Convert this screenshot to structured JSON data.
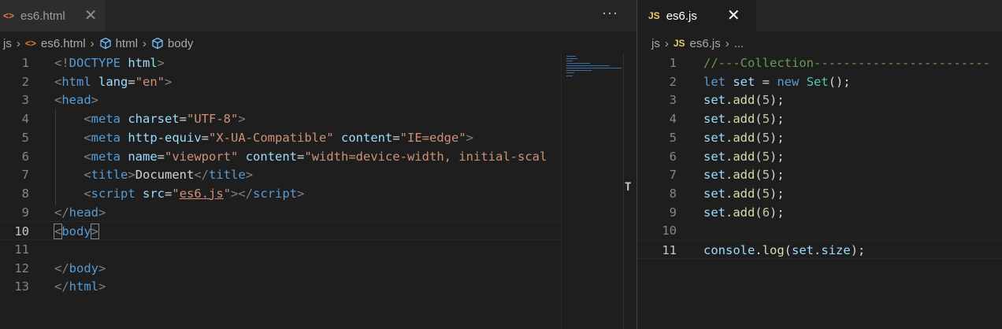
{
  "left_tab": {
    "icon": "<>",
    "label": "es6.html",
    "close": "✕"
  },
  "more_actions": "···",
  "right_tab": {
    "icon": "JS",
    "label": "es6.js",
    "close": "✕"
  },
  "left_breadcrumb": {
    "root": "js",
    "file": "es6.html",
    "node1": "html",
    "node2": "body"
  },
  "right_breadcrumb": {
    "root": "js",
    "file": "es6.js",
    "tail": "..."
  },
  "left_lines": [
    {
      "num": "1",
      "tokens": [
        [
          "t-brk",
          "<!"
        ],
        [
          "t-tag",
          "DOCTYPE"
        ],
        [
          "t-txt",
          " "
        ],
        [
          "t-attr",
          "html"
        ],
        [
          "t-brk",
          ">"
        ]
      ]
    },
    {
      "num": "2",
      "tokens": [
        [
          "t-brk",
          "<"
        ],
        [
          "t-tag",
          "html"
        ],
        [
          "t-txt",
          " "
        ],
        [
          "t-attr",
          "lang"
        ],
        [
          "t-txt",
          "="
        ],
        [
          "t-str",
          "\"en\""
        ],
        [
          "t-brk",
          ">"
        ]
      ]
    },
    {
      "num": "3",
      "tokens": [
        [
          "t-brk",
          "<"
        ],
        [
          "t-tag",
          "head"
        ],
        [
          "t-brk",
          ">"
        ]
      ]
    },
    {
      "num": "4",
      "tokens": [
        [
          "t-txt",
          "    "
        ],
        [
          "t-brk",
          "<"
        ],
        [
          "t-tag",
          "meta"
        ],
        [
          "t-txt",
          " "
        ],
        [
          "t-attr",
          "charset"
        ],
        [
          "t-txt",
          "="
        ],
        [
          "t-str",
          "\"UTF-8\""
        ],
        [
          "t-brk",
          ">"
        ]
      ]
    },
    {
      "num": "5",
      "tokens": [
        [
          "t-txt",
          "    "
        ],
        [
          "t-brk",
          "<"
        ],
        [
          "t-tag",
          "meta"
        ],
        [
          "t-txt",
          " "
        ],
        [
          "t-attr",
          "http-equiv"
        ],
        [
          "t-txt",
          "="
        ],
        [
          "t-str",
          "\"X-UA-Compatible\""
        ],
        [
          "t-txt",
          " "
        ],
        [
          "t-attr",
          "content"
        ],
        [
          "t-txt",
          "="
        ],
        [
          "t-str",
          "\"IE=edge\""
        ],
        [
          "t-brk",
          ">"
        ]
      ]
    },
    {
      "num": "6",
      "tokens": [
        [
          "t-txt",
          "    "
        ],
        [
          "t-brk",
          "<"
        ],
        [
          "t-tag",
          "meta"
        ],
        [
          "t-txt",
          " "
        ],
        [
          "t-attr",
          "name"
        ],
        [
          "t-txt",
          "="
        ],
        [
          "t-str",
          "\"viewport\""
        ],
        [
          "t-txt",
          " "
        ],
        [
          "t-attr",
          "content"
        ],
        [
          "t-txt",
          "="
        ],
        [
          "t-str",
          "\"width=device-width, initial-scal"
        ]
      ]
    },
    {
      "num": "7",
      "tokens": [
        [
          "t-txt",
          "    "
        ],
        [
          "t-brk",
          "<"
        ],
        [
          "t-tag",
          "title"
        ],
        [
          "t-brk",
          ">"
        ],
        [
          "t-txt",
          "Document"
        ],
        [
          "t-brk",
          "</"
        ],
        [
          "t-tag",
          "title"
        ],
        [
          "t-brk",
          ">"
        ]
      ]
    },
    {
      "num": "8",
      "tokens": [
        [
          "t-txt",
          "    "
        ],
        [
          "t-brk",
          "<"
        ],
        [
          "t-tag",
          "script"
        ],
        [
          "t-txt",
          " "
        ],
        [
          "t-attr",
          "src"
        ],
        [
          "t-txt",
          "="
        ],
        [
          "t-str",
          "\""
        ],
        [
          "t-str t-ul",
          "es6.js"
        ],
        [
          "t-str",
          "\""
        ],
        [
          "t-brk",
          "></"
        ],
        [
          "t-tag",
          "script"
        ],
        [
          "t-brk",
          ">"
        ]
      ]
    },
    {
      "num": "9",
      "tokens": [
        [
          "t-brk",
          "</"
        ],
        [
          "t-tag",
          "head"
        ],
        [
          "t-brk",
          ">"
        ]
      ]
    },
    {
      "num": "10",
      "current": true,
      "tokens": [
        [
          "t-brk bracket-match",
          "<"
        ],
        [
          "t-tag",
          "body"
        ],
        [
          "t-brk bracket-match",
          ">"
        ]
      ]
    },
    {
      "num": "11",
      "tokens": []
    },
    {
      "num": "12",
      "tokens": [
        [
          "t-brk",
          "</"
        ],
        [
          "t-tag",
          "body"
        ],
        [
          "t-brk",
          ">"
        ]
      ]
    },
    {
      "num": "13",
      "tokens": [
        [
          "t-brk",
          "</"
        ],
        [
          "t-tag",
          "html"
        ],
        [
          "t-brk",
          ">"
        ]
      ]
    }
  ],
  "right_lines": [
    {
      "num": "1",
      "tokens": [
        [
          "t-cmt",
          "//---Collection------------------------"
        ]
      ]
    },
    {
      "num": "2",
      "tokens": [
        [
          "t-kw",
          "let"
        ],
        [
          "t-punc",
          " "
        ],
        [
          "t-var",
          "set"
        ],
        [
          "t-punc",
          " = "
        ],
        [
          "t-kw",
          "new"
        ],
        [
          "t-punc",
          " "
        ],
        [
          "t-cls",
          "Set"
        ],
        [
          "t-punc",
          "();"
        ]
      ]
    },
    {
      "num": "3",
      "tokens": [
        [
          "t-var",
          "set"
        ],
        [
          "t-punc",
          "."
        ],
        [
          "t-fn",
          "add"
        ],
        [
          "t-punc",
          "("
        ],
        [
          "t-num",
          "5"
        ],
        [
          "t-punc",
          ");"
        ]
      ]
    },
    {
      "num": "4",
      "tokens": [
        [
          "t-var",
          "set"
        ],
        [
          "t-punc",
          "."
        ],
        [
          "t-fn",
          "add"
        ],
        [
          "t-punc",
          "("
        ],
        [
          "t-num",
          "5"
        ],
        [
          "t-punc",
          ");"
        ]
      ]
    },
    {
      "num": "5",
      "tokens": [
        [
          "t-var",
          "set"
        ],
        [
          "t-punc",
          "."
        ],
        [
          "t-fn",
          "add"
        ],
        [
          "t-punc",
          "("
        ],
        [
          "t-num",
          "5"
        ],
        [
          "t-punc",
          ");"
        ]
      ]
    },
    {
      "num": "6",
      "tokens": [
        [
          "t-var",
          "set"
        ],
        [
          "t-punc",
          "."
        ],
        [
          "t-fn",
          "add"
        ],
        [
          "t-punc",
          "("
        ],
        [
          "t-num",
          "5"
        ],
        [
          "t-punc",
          ");"
        ]
      ]
    },
    {
      "num": "7",
      "tokens": [
        [
          "t-var",
          "set"
        ],
        [
          "t-punc",
          "."
        ],
        [
          "t-fn",
          "add"
        ],
        [
          "t-punc",
          "("
        ],
        [
          "t-num",
          "5"
        ],
        [
          "t-punc",
          ");"
        ]
      ]
    },
    {
      "num": "8",
      "tokens": [
        [
          "t-var",
          "set"
        ],
        [
          "t-punc",
          "."
        ],
        [
          "t-fn",
          "add"
        ],
        [
          "t-punc",
          "("
        ],
        [
          "t-num",
          "5"
        ],
        [
          "t-punc",
          ");"
        ]
      ]
    },
    {
      "num": "9",
      "tokens": [
        [
          "t-var",
          "set"
        ],
        [
          "t-punc",
          "."
        ],
        [
          "t-fn",
          "add"
        ],
        [
          "t-punc",
          "("
        ],
        [
          "t-num",
          "6"
        ],
        [
          "t-punc",
          ");"
        ]
      ]
    },
    {
      "num": "10",
      "tokens": []
    },
    {
      "num": "11",
      "current": true,
      "tokens": [
        [
          "t-var",
          "console"
        ],
        [
          "t-punc",
          "."
        ],
        [
          "t-fn",
          "log"
        ],
        [
          "t-punc",
          "("
        ],
        [
          "t-var",
          "set"
        ],
        [
          "t-punc",
          "."
        ],
        [
          "t-var",
          "size"
        ],
        [
          "t-punc",
          ");"
        ]
      ]
    }
  ],
  "colors": {
    "editor_bg": "#1e1e1e",
    "tabbar_bg": "#252526",
    "html_icon": "#e37933",
    "js_icon": "#e6cd69"
  }
}
